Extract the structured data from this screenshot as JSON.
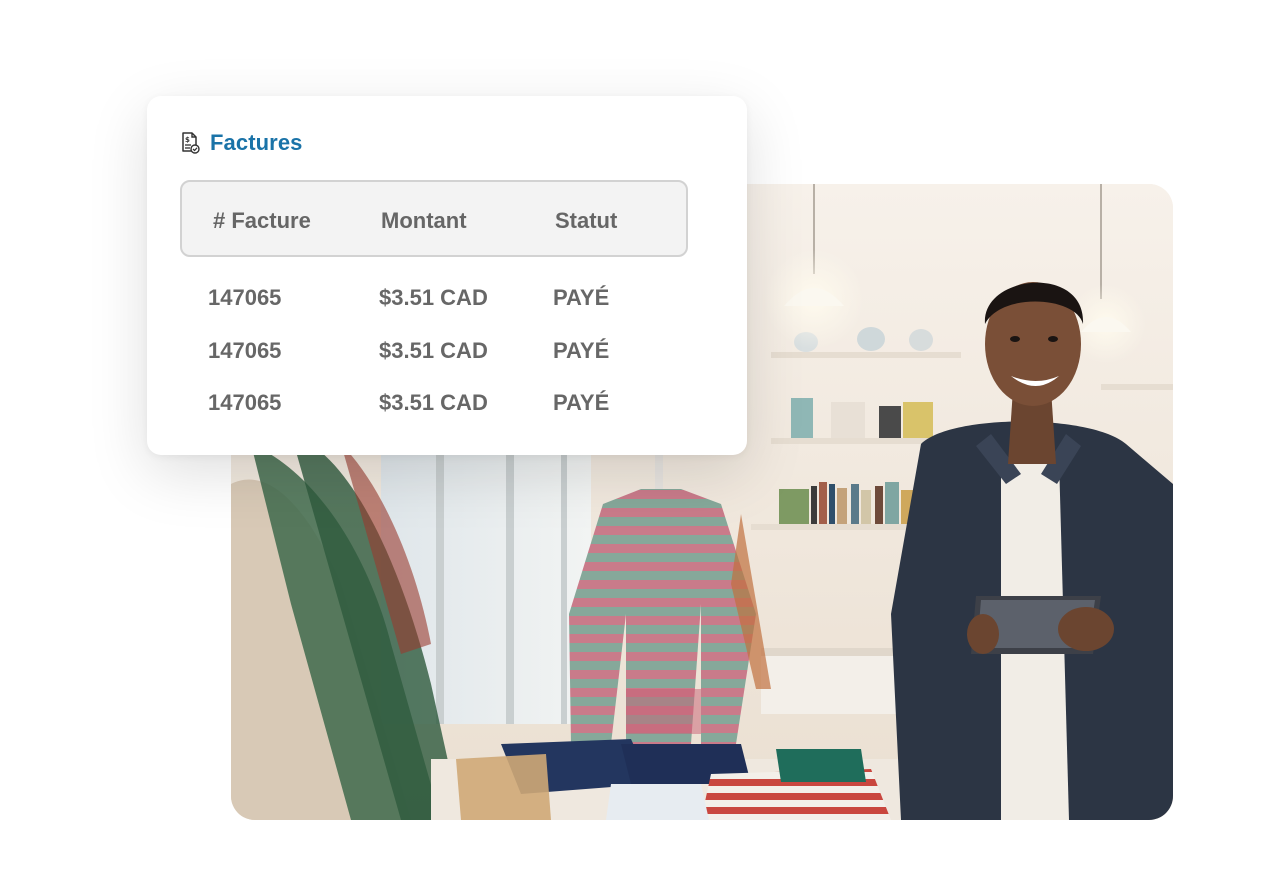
{
  "card": {
    "title": "Factures",
    "title_icon": "invoice-icon",
    "accent_color": "#1a73a8",
    "columns": [
      "# Facture",
      "Montant",
      "Statut"
    ],
    "rows": [
      {
        "invoice": "147065",
        "amount": "$3.51 CAD",
        "status": "PAYÉ"
      },
      {
        "invoice": "147065",
        "amount": "$3.51 CAD",
        "status": "PAYÉ"
      },
      {
        "invoice": "147065",
        "amount": "$3.51 CAD",
        "status": "PAYÉ"
      }
    ]
  },
  "photo": {
    "subject": "smiling-shop-owner-with-tablet"
  }
}
